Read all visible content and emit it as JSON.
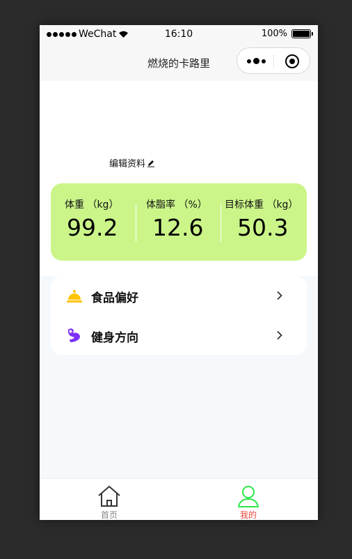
{
  "status_bar": {
    "carrier": "WeChat",
    "time": "16:10",
    "battery": "100%"
  },
  "navbar": {
    "title": "燃烧的卡路里"
  },
  "profile": {
    "edit_label": "编辑资料"
  },
  "stats": [
    {
      "label": "体重 （kg）",
      "value": "99.2"
    },
    {
      "label": "体脂率 （%）",
      "value": "12.6"
    },
    {
      "label": "目标体重 （kg）",
      "value": "50.3"
    }
  ],
  "menu": [
    {
      "label": "食品偏好",
      "icon": "food-cloche-icon",
      "icon_color": "#ffc300"
    },
    {
      "label": "健身方向",
      "icon": "muscle-arm-icon",
      "icon_color": "#7b2ff7"
    }
  ],
  "tabbar": {
    "items": [
      {
        "label": "首页",
        "icon": "home-icon",
        "active": false
      },
      {
        "label": "我的",
        "icon": "user-icon",
        "active": true
      }
    ],
    "inactive_color": "#888888",
    "active_label_color": "#e8453c",
    "active_icon_color": "#2ee84a"
  },
  "colors": {
    "stats_card": "#cbf589",
    "page_background": "#f6f9fc"
  }
}
